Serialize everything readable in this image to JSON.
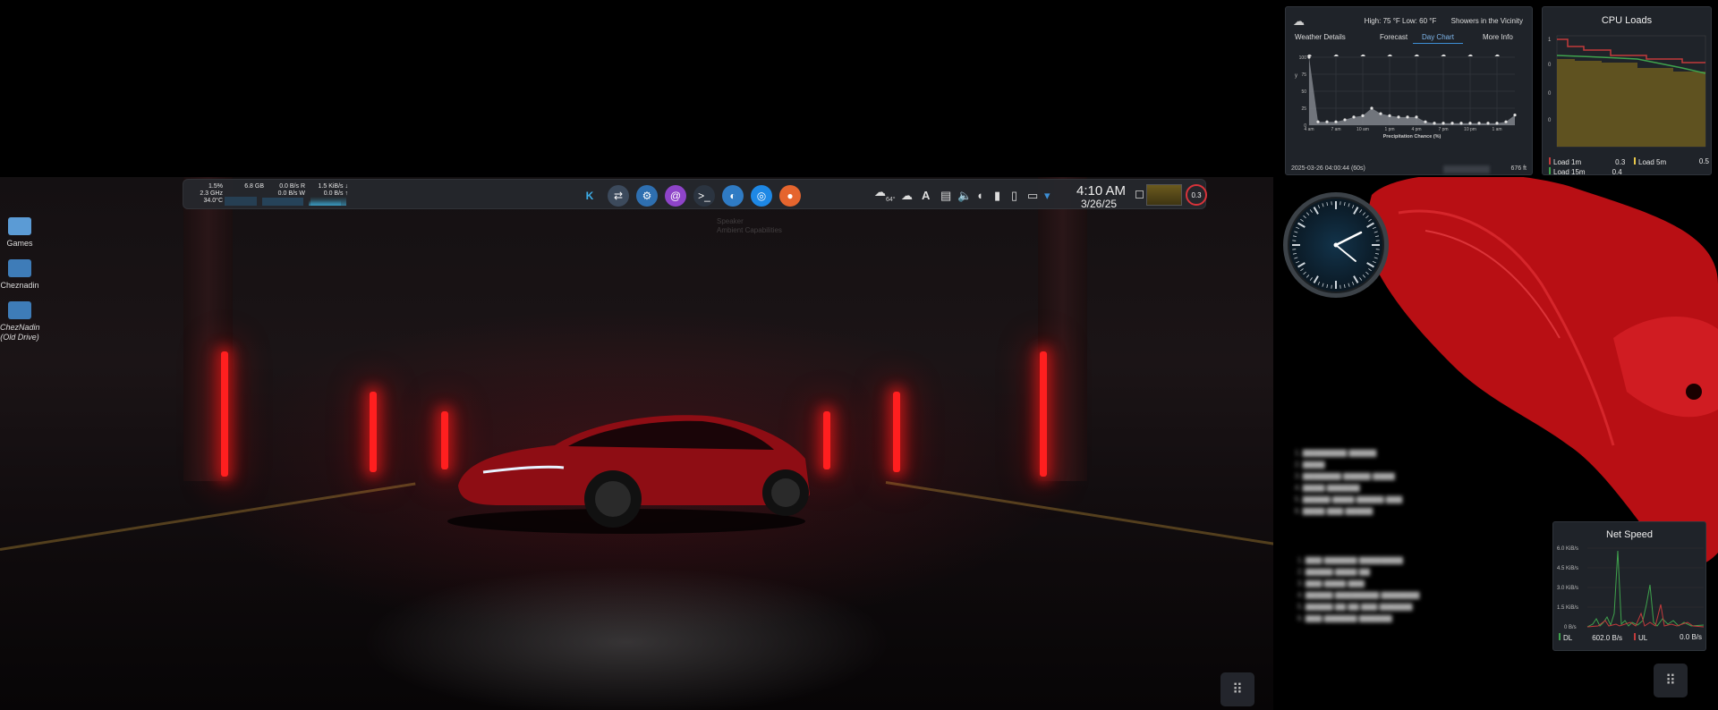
{
  "desktop": {
    "icons": [
      {
        "label": "Games"
      },
      {
        "label": "Cheznadin"
      },
      {
        "label": "ChezNadin (Old Drive)"
      }
    ]
  },
  "panel": {
    "sysmon": {
      "cpu_percent": "1.5%",
      "cpu_freq": "2.3 GHz",
      "cpu_temp": "34.0°C",
      "memory": "6.8 GB",
      "disk_read": "0.0 B/s",
      "disk_write": "0.0 B/s",
      "disk_read_label": "R",
      "disk_write_label": "W",
      "net_down": "1.5 KiB/s",
      "net_up": "0.0 B/s"
    },
    "apps": [
      {
        "icon": "kde-icon"
      },
      {
        "icon": "settings-toggle-icon"
      },
      {
        "icon": "system-settings-icon"
      },
      {
        "icon": "spiral-app-icon"
      },
      {
        "icon": "terminal-icon"
      },
      {
        "icon": "dolphin-file-manager-icon"
      },
      {
        "icon": "browser-blue-icon"
      },
      {
        "icon": "firefox-icon"
      }
    ],
    "weather_temp": "64°",
    "clock_time": "4:10 AM",
    "clock_date": "3/26/25",
    "cpu_badge": "0.3",
    "ghost_text": "Speaker",
    "ghost_sub": "Ambient Capabilities"
  },
  "weather": {
    "high_low": "High: 75 °F Low: 60 °F",
    "condition": "Showers in the Vicinity",
    "tabs": [
      "Weather Details",
      "Forecast",
      "Day Chart",
      "More Info"
    ],
    "active_tab": "Day Chart",
    "y_axis_label": "y",
    "x_title": "Precipitation Chance (%)",
    "y_ticks": [
      "100",
      "75",
      "50",
      "25",
      "0"
    ],
    "x_ticks": [
      "4 am",
      "7 am",
      "10 am",
      "1 pm",
      "4 pm",
      "7 pm",
      "10 pm",
      "1 am"
    ],
    "footer_time": "2025-03-26 04:00:44 (60s)",
    "footer_elevation": "676 ft",
    "accent": "#3d8fd6"
  },
  "chart_data": {
    "type": "area",
    "title": "",
    "xlabel": "Precipitation Chance (%)",
    "ylabel": "y",
    "ylim": [
      0,
      100
    ],
    "x": [
      "4 am",
      "5 am",
      "6 am",
      "7 am",
      "8 am",
      "9 am",
      "10 am",
      "11 am",
      "12 pm",
      "1 pm",
      "2 pm",
      "3 pm",
      "4 pm",
      "5 pm",
      "6 pm",
      "7 pm",
      "8 pm",
      "9 pm",
      "10 pm",
      "11 pm",
      "12 am",
      "1 am",
      "2 am",
      "3 am"
    ],
    "series": [
      {
        "values": [
          100,
          5,
          5,
          5,
          8,
          12,
          14,
          25,
          17,
          14,
          12,
          12,
          12,
          5,
          3,
          3,
          3,
          3,
          3,
          3,
          3,
          3,
          5,
          15
        ]
      }
    ]
  },
  "cpu": {
    "title": "CPU Loads",
    "y_ticks": [
      "1",
      "0",
      "0",
      "0"
    ],
    "load1_label": "Load 1m",
    "load1_value": "0.3",
    "load5_label": "Load 5m",
    "load5_value": "0.5",
    "load15_label": "Load 15m",
    "load15_value": "0.4",
    "colors": {
      "load1": "#c23b3b",
      "load5": "#e8c84a",
      "load15": "#3fa34d"
    }
  },
  "netspeed": {
    "title": "Net Speed",
    "y_ticks": [
      "6.0 KiB/s",
      "4.5 KiB/s",
      "3.0 KiB/s",
      "1.5 KiB/s",
      "0 B/s"
    ],
    "dl_label": "DL",
    "dl_value": "602.0 B/s",
    "ul_label": "UL",
    "ul_value": "0.0 B/s",
    "colors": {
      "dl": "#3fa34d",
      "ul": "#c23b3b"
    }
  }
}
